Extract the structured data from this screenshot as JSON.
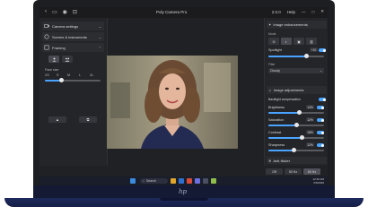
{
  "app": {
    "title": "Poly Camera Pro",
    "window_controls": [
      "2.0.0",
      "Help",
      "—",
      "□",
      "✕"
    ]
  },
  "left_panel": {
    "camera_settings": "Camera settings",
    "scenes": "Scenes & instruments",
    "framing": "Framing",
    "face_size_label": "Face size",
    "scale_labels": [
      "XS",
      "S",
      "M",
      "L",
      "XL"
    ],
    "buttons": [
      "▲",
      "⧉"
    ]
  },
  "right_panel": {
    "image_enhancements": "Image enhancements",
    "mode_label": "Mode",
    "spotlight_label": "Spotlight",
    "spotlight_value": "+10",
    "filter_label": "Filter",
    "filter_value": "Cloudy",
    "image_adjustments": "Image adjustments",
    "backlight_label": "Backlight compensation",
    "sliders": [
      {
        "label": "Brightness",
        "value": "14%",
        "fill": 0.55
      },
      {
        "label": "Saturation",
        "value": "12%",
        "fill": 0.5
      },
      {
        "label": "Contrast",
        "value": "18%",
        "fill": 0.6
      },
      {
        "label": "Sharpness",
        "value": "12%",
        "fill": 0.45
      }
    ],
    "anti_flicker_label": "Anti-flicker",
    "anti_flicker_options": [
      "Off",
      "50 Hz",
      "60 Hz"
    ],
    "anti_flicker_selected": "60 Hz"
  },
  "taskbar": {
    "search_placeholder": "Search",
    "time": "12:46 AM",
    "date": "6/5/2025"
  },
  "colors": {
    "accent": "#4aa3ff",
    "panel": "#242528",
    "chassis": "#141a33"
  }
}
